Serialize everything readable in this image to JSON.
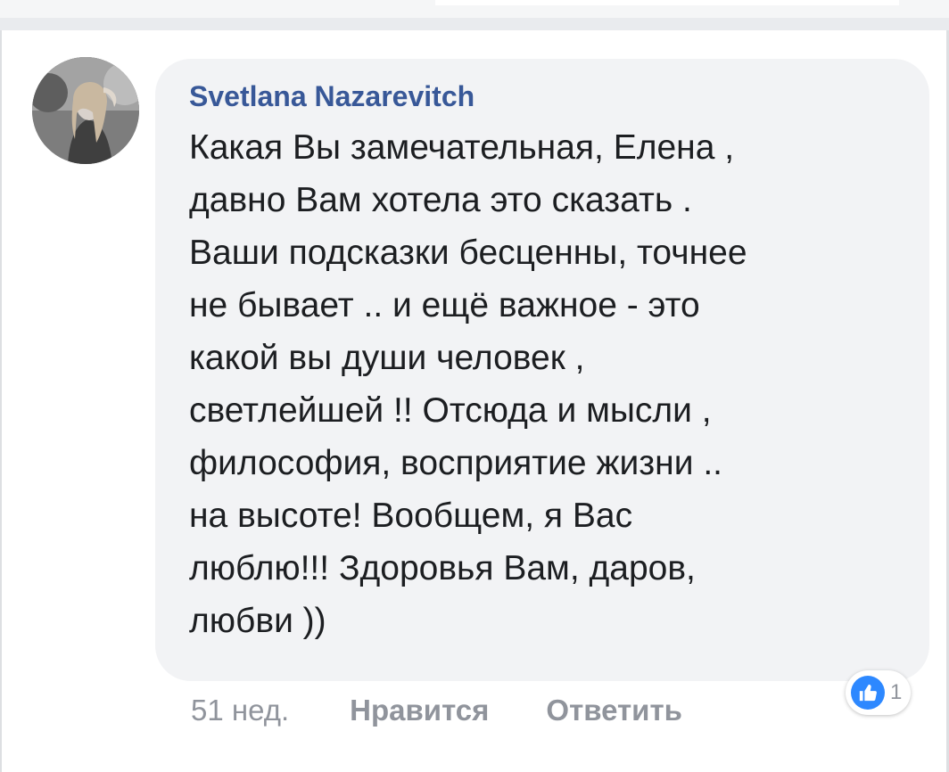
{
  "comment": {
    "author": "Svetlana Nazarevitch",
    "text": "Какая Вы замечательная, Елена ,\nдавно Вам хотела это сказать .\nВаши подсказки бесценны, точнее\nне бывает .. и ещё важное - это\nкакой вы души человек ,\nсветлейшей !! Отсюда и мысли ,\nфилософия, восприятие жизни ..\nна высоте! Вообщем, я Вас\nлюблю!!! Здоровья Вам, даров,\nлюбви ))",
    "timestamp": "51 нед.",
    "like_label": "Нравится",
    "reply_label": "Ответить",
    "reaction_icon": "like-icon",
    "reaction_count": "1"
  },
  "colors": {
    "author": "#385898",
    "text": "#1c1e21",
    "meta": "#90949c",
    "bubble": "#f2f3f5",
    "like_blue": "#2d88ff"
  }
}
